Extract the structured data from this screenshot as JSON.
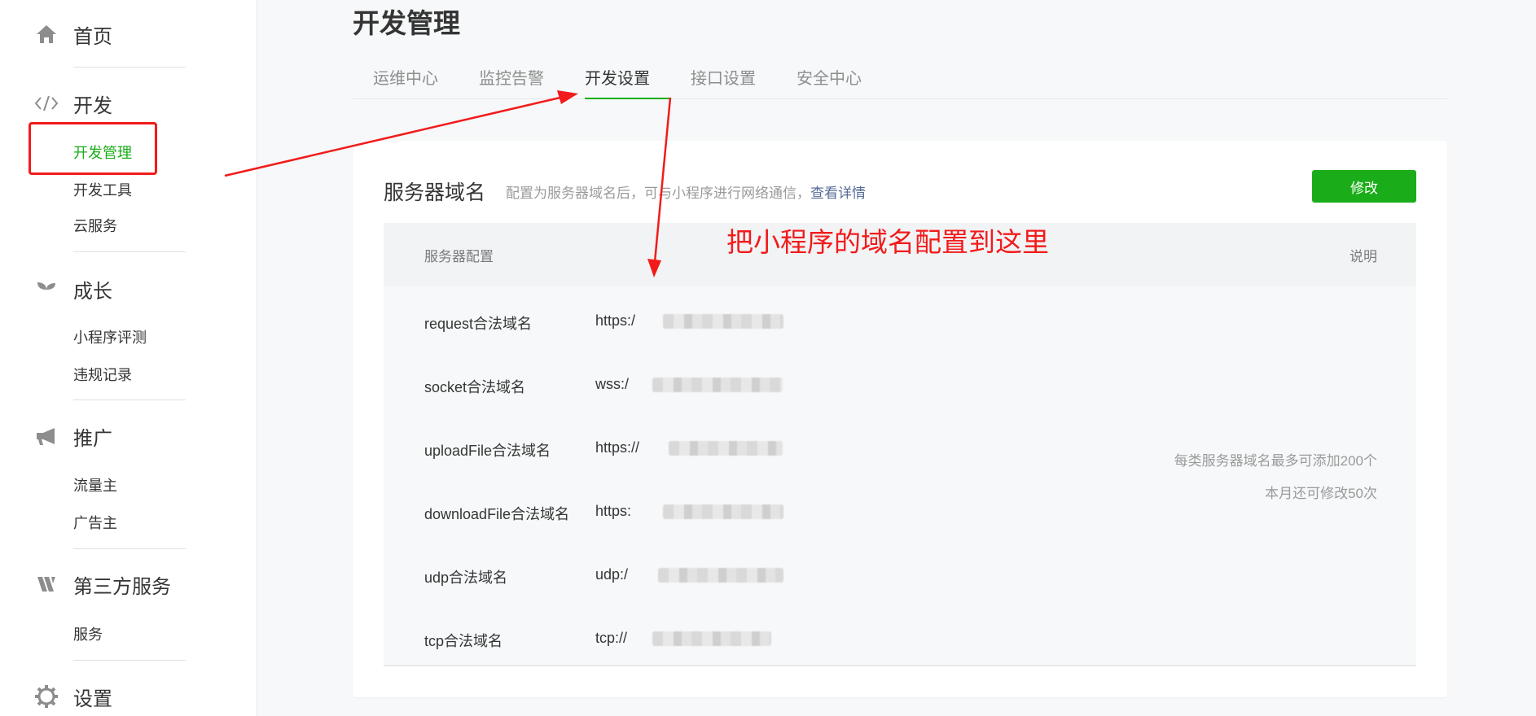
{
  "sidebar": {
    "home": {
      "icon": "home-icon",
      "label": "首页"
    },
    "dev": {
      "icon": "code-icon",
      "label": "开发",
      "items": [
        "开发管理",
        "开发工具",
        "云服务"
      ]
    },
    "growth": {
      "icon": "sprout-icon",
      "label": "成长",
      "items": [
        "小程序评测",
        "违规记录"
      ]
    },
    "promote": {
      "icon": "megaphone-icon",
      "label": "推广",
      "items": [
        "流量主",
        "广告主"
      ]
    },
    "third_party": {
      "icon": "third-party-icon",
      "label": "第三方服务",
      "items": [
        "服务"
      ]
    },
    "settings": {
      "icon": "gear-icon",
      "label": "设置"
    }
  },
  "page": {
    "title": "开发管理"
  },
  "tabs": [
    {
      "label": "运维中心",
      "active": false
    },
    {
      "label": "监控告警",
      "active": false
    },
    {
      "label": "开发设置",
      "active": true
    },
    {
      "label": "接口设置",
      "active": false
    },
    {
      "label": "安全中心",
      "active": false
    }
  ],
  "card": {
    "title": "服务器域名",
    "desc": "配置为服务器域名后，可与小程序进行网络通信，",
    "link": "查看详情",
    "edit_button": "修改",
    "columns": {
      "config": "服务器配置",
      "note": "说明"
    },
    "rows": [
      {
        "label": "request合法域名",
        "prefix": "https:/"
      },
      {
        "label": "socket合法域名",
        "prefix": "wss:/"
      },
      {
        "label": "uploadFile合法域名",
        "prefix": "https://"
      },
      {
        "label": "downloadFile合法域名",
        "prefix": "https:"
      },
      {
        "label": "udp合法域名",
        "prefix": "udp:/"
      },
      {
        "label": "tcp合法域名",
        "prefix": "tcp://"
      }
    ],
    "notes": [
      "每类服务器域名最多可添加200个",
      "本月还可修改50次"
    ]
  },
  "annotation": "把小程序的域名配置到这里",
  "colors": {
    "accent": "#1aad19",
    "annotation_red": "#f21b1b",
    "link": "#576b95"
  }
}
